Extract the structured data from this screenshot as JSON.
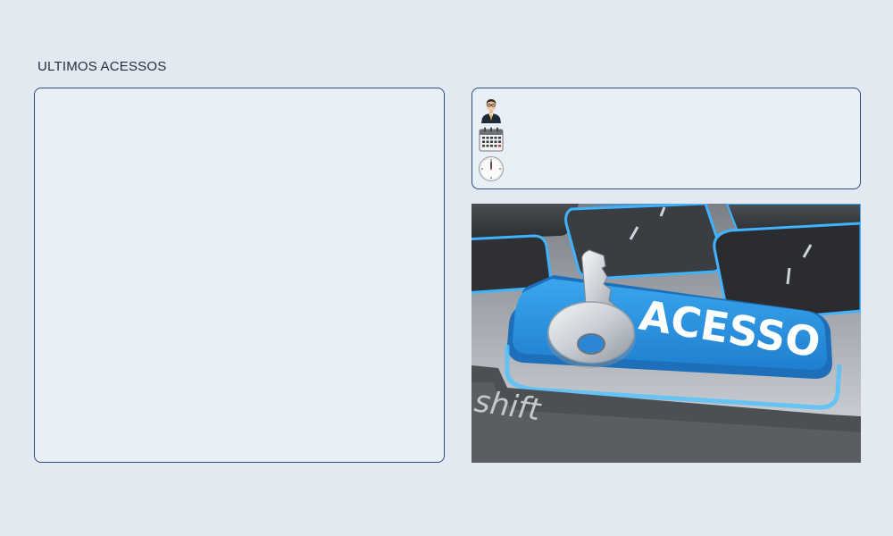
{
  "section": {
    "title": "ULTIMOS ACESSOS"
  },
  "access_list": {
    "items": []
  },
  "info": {
    "user": {
      "icon": "user-avatar-icon",
      "value": ""
    },
    "date": {
      "icon": "calendar-icon",
      "value": ""
    },
    "time": {
      "icon": "clock-icon",
      "value": ""
    }
  },
  "banner": {
    "key_label": "ACESSO",
    "shift_label": "shift",
    "key_color": "#2f9be6"
  }
}
